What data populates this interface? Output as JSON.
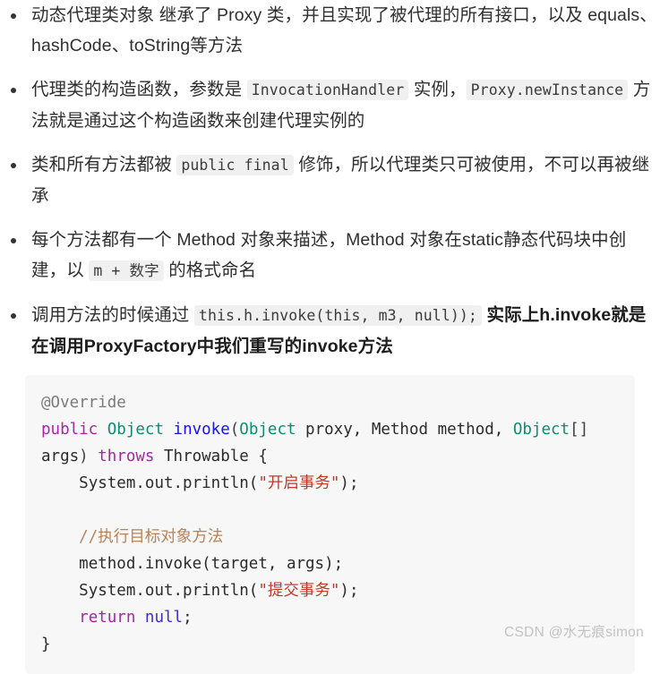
{
  "theme": {
    "page_bg": "#ffffff",
    "text_color": "#2f2f2f",
    "inline_code_bg": "#f0f0f0",
    "code_block_bg": "#f7f7f7",
    "bullet_color": "#333333",
    "watermark_color": "#c2c2c2",
    "syntax": {
      "annotation": "#7b7b7b",
      "keyword": "#a626a4",
      "type": "#0e8c72",
      "function": "#1515e0",
      "string": "#c0392b",
      "comment": "#b5835a",
      "constant": "#3b2ec4",
      "punctuation": "#3f3f46"
    }
  },
  "bullets": [
    {
      "id": "bullet-dynamic-proxy-inherits",
      "parts": [
        {
          "type": "text",
          "value": "动态代理类对象 继承了 Proxy 类，并且实现了被代理的所有接口，以及 equals、hashCode、toString等方法"
        }
      ]
    },
    {
      "id": "bullet-constructor-invocationhandler",
      "parts": [
        {
          "type": "text",
          "value": "代理类的构造函数，参数是 "
        },
        {
          "type": "code",
          "value": "InvocationHandler"
        },
        {
          "type": "text",
          "value": " 实例，"
        },
        {
          "type": "code",
          "value": "Proxy.newInstance"
        },
        {
          "type": "text",
          "value": " 方法就是通过这个构造函数来创建代理实例的"
        }
      ]
    },
    {
      "id": "bullet-public-final",
      "parts": [
        {
          "type": "text",
          "value": "类和所有方法都被 "
        },
        {
          "type": "code",
          "value": "public final"
        },
        {
          "type": "text",
          "value": " 修饰，所以代理类只可被使用，不可以再被继承"
        }
      ]
    },
    {
      "id": "bullet-method-object-static",
      "parts": [
        {
          "type": "text",
          "value": "每个方法都有一个 Method 对象来描述，Method 对象在static静态代码块中创建，以 "
        },
        {
          "type": "code",
          "value": "m + 数字"
        },
        {
          "type": "text",
          "value": " 的格式命名"
        }
      ]
    },
    {
      "id": "bullet-invoke-call",
      "parts": [
        {
          "type": "text",
          "value": "调用方法的时候通过 "
        },
        {
          "type": "code",
          "value": "this.h.invoke(this, m3, null));"
        },
        {
          "type": "bold",
          "value": " 实际上h.invoke就是在调用ProxyFactory中我们重写的invoke方法"
        }
      ]
    }
  ],
  "code_block": {
    "language": "java",
    "plain_text": "@Override\npublic Object invoke(Object proxy, Method method, Object[] args) throws Throwable {\n    System.out.println(\"开启事务\");\n\n    //执行目标对象方法\n    method.invoke(target, args);\n    System.out.println(\"提交事务\");\n    return null;\n}",
    "lines": [
      {
        "tokens": [
          {
            "t": "anno",
            "v": "@Override"
          }
        ]
      },
      {
        "tokens": [
          {
            "t": "kw",
            "v": "public"
          },
          {
            "t": "plain",
            "v": " "
          },
          {
            "t": "type",
            "v": "Object"
          },
          {
            "t": "plain",
            "v": " "
          },
          {
            "t": "fn",
            "v": "invoke"
          },
          {
            "t": "punc",
            "v": "("
          },
          {
            "t": "type",
            "v": "Object"
          },
          {
            "t": "plain",
            "v": " proxy, "
          },
          {
            "t": "plain",
            "v": "Method"
          },
          {
            "t": "plain",
            "v": " method, "
          },
          {
            "t": "type",
            "v": "Object"
          },
          {
            "t": "punc",
            "v": "[]"
          },
          {
            "t": "plain",
            "v": " args"
          },
          {
            "t": "punc",
            "v": ")"
          },
          {
            "t": "plain",
            "v": " "
          },
          {
            "t": "kw",
            "v": "throws"
          },
          {
            "t": "plain",
            "v": " Throwable {"
          }
        ]
      },
      {
        "tokens": [
          {
            "t": "plain",
            "v": "    System.out.println("
          },
          {
            "t": "str",
            "v": "\"开启事务\""
          },
          {
            "t": "plain",
            "v": ");"
          }
        ]
      },
      {
        "tokens": [
          {
            "t": "plain",
            "v": ""
          }
        ]
      },
      {
        "tokens": [
          {
            "t": "com",
            "v": "    //执行目标对象方法"
          }
        ]
      },
      {
        "tokens": [
          {
            "t": "plain",
            "v": "    method.invoke(target, args);"
          }
        ]
      },
      {
        "tokens": [
          {
            "t": "plain",
            "v": "    System.out.println("
          },
          {
            "t": "str",
            "v": "\"提交事务\""
          },
          {
            "t": "plain",
            "v": ");"
          }
        ]
      },
      {
        "tokens": [
          {
            "t": "plain",
            "v": "    "
          },
          {
            "t": "kw",
            "v": "return"
          },
          {
            "t": "plain",
            "v": " "
          },
          {
            "t": "const",
            "v": "null"
          },
          {
            "t": "plain",
            "v": ";"
          }
        ]
      },
      {
        "tokens": [
          {
            "t": "plain",
            "v": "}"
          }
        ]
      }
    ]
  },
  "watermark": {
    "text": "CSDN @水无痕simon"
  }
}
